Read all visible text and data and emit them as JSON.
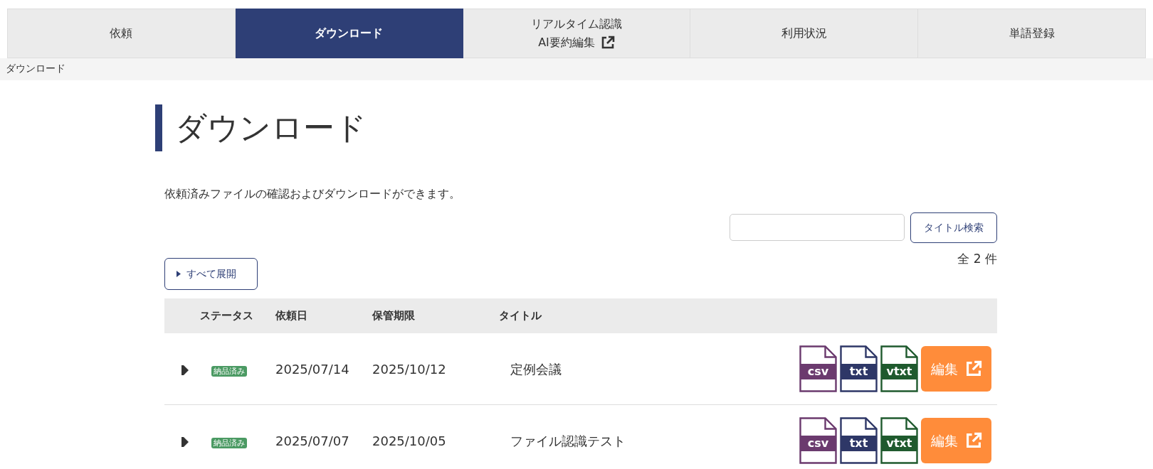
{
  "nav_tabs": [
    {
      "lines": [
        "依頼"
      ],
      "external": false,
      "selected": false
    },
    {
      "lines": [
        "ダウンロード"
      ],
      "external": false,
      "selected": true
    },
    {
      "lines": [
        "リアルタイム認識",
        "AI要約編集"
      ],
      "external": true,
      "selected": false
    },
    {
      "lines": [
        "利用状況"
      ],
      "external": false,
      "selected": false
    },
    {
      "lines": [
        "単語登録"
      ],
      "external": false,
      "selected": false
    }
  ],
  "breadcrumb": "ダウンロード",
  "heading": "ダウンロード",
  "description": "依頼済みファイルの確認およびダウンロードができます。",
  "search": {
    "button": "タイトル検索"
  },
  "expand_all": "すべて展開",
  "count": "全 2 件",
  "table": {
    "columns": [
      "ステータス",
      "依頼日",
      "保管期限",
      "タイトル"
    ],
    "rows": [
      {
        "expanded": false,
        "status": "納品済み",
        "requested": "2025/07/14",
        "expires": "2025/10/12",
        "title": "定例会議",
        "files": [
          {
            "label": "csv",
            "color": "#6b3a6e"
          },
          {
            "label": "txt",
            "color": "#2e3767"
          },
          {
            "label": "vtxt",
            "color": "#1f5a2e"
          }
        ],
        "edit": "編集"
      },
      {
        "expanded": false,
        "status": "納品済み",
        "requested": "2025/07/07",
        "expires": "2025/10/05",
        "title": "ファイル認識テスト",
        "files": [
          {
            "label": "csv",
            "color": "#6b3a6e"
          },
          {
            "label": "txt",
            "color": "#2e3767"
          },
          {
            "label": "vtxt",
            "color": "#1f5a2e"
          }
        ],
        "edit": "編集"
      }
    ]
  }
}
